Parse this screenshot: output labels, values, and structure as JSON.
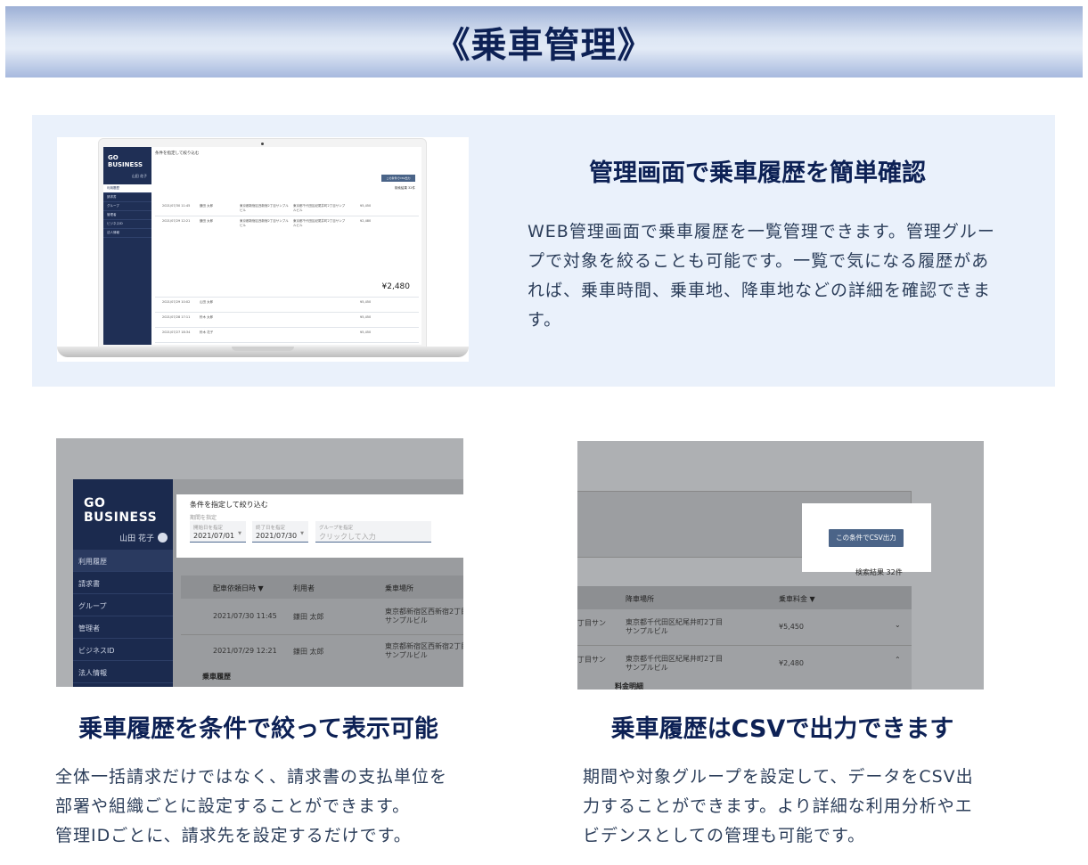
{
  "banner": {
    "title": "《乗車管理》"
  },
  "feature": {
    "title": "管理画面で乗車履歴を簡単確認",
    "body": "WEB管理画面で乗車履歴を一覧管理できます。管理グループで対象を絞ることも可能です。一覧で気になる履歴があれば、乗車時間、乗車地、降車地などの詳細を確認できます。",
    "lines": [
      "WEB管理画面で乗車履歴を一覧管理できます。管理グルー",
      "プで対象を絞ることも可能です。一覧で気になる履歴があ",
      "れば、乗車時間、乗車地、降車地などの詳細を確認できま",
      "す。"
    ],
    "mockup": {
      "logo": "GO BUSINESS",
      "user": "山田 花子",
      "filter_title": "条件を指定して絞り込む",
      "csv_button": "この条件でCSV出力",
      "result_count": "検索結果 32件",
      "nav": [
        "利用履歴",
        "請求書",
        "グループ",
        "管理者",
        "ビジネスID",
        "法人情報"
      ],
      "rows": [
        {
          "date": "2021/07/30 11:45",
          "user": "鎌田 太郎",
          "pickup": "東京都新宿区西新宿2丁目サンプルビル",
          "dropoff": "東京都千代田区紀尾井町2丁目サンプルビル",
          "fare": "¥5,450"
        },
        {
          "date": "2021/07/29 12:21",
          "user": "鎌田 太郎",
          "pickup": "東京都新宿区西新宿2丁目サンプルビル",
          "dropoff": "東京都千代田区紀尾井町2丁目サンプルビル",
          "fare": "¥2,480"
        },
        {
          "date": "2021/07/29 10:02",
          "user": "山田 太郎",
          "pickup": "東京都新宿区西新宿2丁目サンプルビル",
          "dropoff": "東京都千代田区紀尾井町2丁目サンプルビル",
          "fare": "¥5,450"
        },
        {
          "date": "2021/07/28 17:11",
          "user": "鈴木 太郎",
          "pickup": "東京都新宿区西新宿2丁目サンプルビル",
          "dropoff": "東京都千代田区紀尾井町2丁目サンプルビル",
          "fare": "¥5,450"
        },
        {
          "date": "2021/07/27 18:34",
          "user": "鈴木 花子",
          "pickup": "東京都新宿区西新宿2丁目サンプルビル",
          "dropoff": "東京都千代田区紀尾井町2丁目サンプルビル",
          "fare": "¥5,450"
        },
        {
          "date": "2021/07/26 17:53",
          "user": "鎌田 太郎",
          "pickup": "東京都新宿区西新宿2丁目サンプルビル",
          "dropoff": "東京都千代田区紀尾井町2丁目サンプルビル",
          "fare": "¥5,450"
        }
      ],
      "total": "¥2,480"
    }
  },
  "shot1": {
    "logo": "GO BUSINESS",
    "user": "山田 花子",
    "nav": [
      "利用履歴",
      "請求書",
      "グループ",
      "管理者",
      "ビジネスID",
      "法人情報"
    ],
    "filter": {
      "title": "条件を指定して絞り込む",
      "period_label": "期間を指定",
      "start_label": "開始日を指定",
      "start_value": "2021/07/01",
      "end_label": "終了日を指定",
      "end_value": "2021/07/30",
      "group_label": "グループを指定",
      "group_placeholder": "クリックして入力"
    },
    "columns": [
      "配車依頼日時",
      "利用者",
      "乗車場所"
    ],
    "rows": [
      {
        "date": "2021/07/30 11:45",
        "user": "鎌田 太郎",
        "pickup": "東京都新宿区西新宿2丁目サンプルビル"
      },
      {
        "date": "2021/07/29 12:21",
        "user": "鎌田 太郎",
        "pickup": "東京都新宿区西新宿2丁目サンプルビル"
      }
    ],
    "subheading": "乗車履歴"
  },
  "shot2": {
    "csv_button": "この条件でCSV出力",
    "result_count": "検索結果 32件",
    "columns": [
      "降車場所",
      "乗車料金"
    ],
    "rows": [
      {
        "pickup_tail": "丁目サン",
        "dropoff": "東京都千代田区紀尾井町2丁目サンプルビル",
        "fare": "¥5,450"
      },
      {
        "pickup_tail": "丁目サン",
        "dropoff": "東京都千代田区紀尾井町2丁目サンプルビル",
        "fare": "¥2,480"
      }
    ],
    "subheading": "料金明細"
  },
  "left": {
    "title": "乗車履歴を条件で絞って表示可能",
    "lines": [
      "全体一括請求だけではなく、請求書の支払単位を",
      "部署や組織ごとに設定することができます。",
      "管理IDごとに、請求先を設定するだけです。"
    ]
  },
  "right": {
    "title": "乗車履歴はCSVで出力できます",
    "lines": [
      "期間や対象グループを設定して、データをCSV出",
      "力することができます。より詳細な利用分析やエ",
      "ビデンスとしての管理も可能です。"
    ]
  }
}
